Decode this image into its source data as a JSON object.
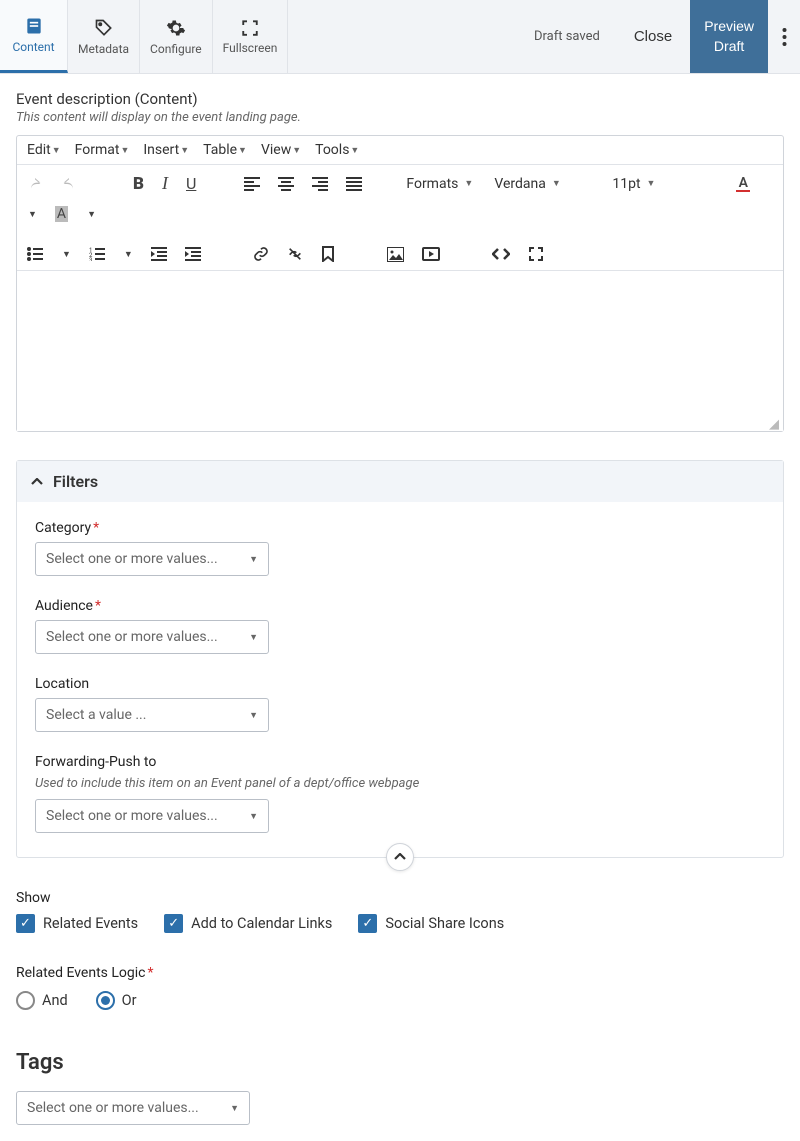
{
  "topbar": {
    "tabs": [
      {
        "label": "Content"
      },
      {
        "label": "Metadata"
      },
      {
        "label": "Configure"
      },
      {
        "label": "Fullscreen"
      }
    ],
    "draft_saved": "Draft saved",
    "close": "Close",
    "preview_line1": "Preview",
    "preview_line2": "Draft"
  },
  "editor": {
    "title": "Event description (Content)",
    "help": "This content will display on the event landing page.",
    "menu": {
      "edit": "Edit",
      "format": "Format",
      "insert": "Insert",
      "table": "Table",
      "view": "View",
      "tools": "Tools"
    },
    "formats": "Formats",
    "font": "Verdana",
    "size": "11pt"
  },
  "filters": {
    "title": "Filters",
    "category": {
      "label": "Category",
      "placeholder": "Select one or more values..."
    },
    "audience": {
      "label": "Audience",
      "placeholder": "Select one or more values..."
    },
    "location": {
      "label": "Location",
      "placeholder": "Select a value ..."
    },
    "forwarding": {
      "label": "Forwarding-Push to",
      "help": "Used to include this item on an Event panel of a dept/office webpage",
      "placeholder": "Select one or more values..."
    }
  },
  "show": {
    "label": "Show",
    "related": "Related Events",
    "calendar": "Add to Calendar Links",
    "social": "Social Share Icons"
  },
  "logic": {
    "label": "Related Events Logic",
    "and": "And",
    "or": "Or"
  },
  "tags": {
    "heading": "Tags",
    "placeholder": "Select one or more values..."
  }
}
